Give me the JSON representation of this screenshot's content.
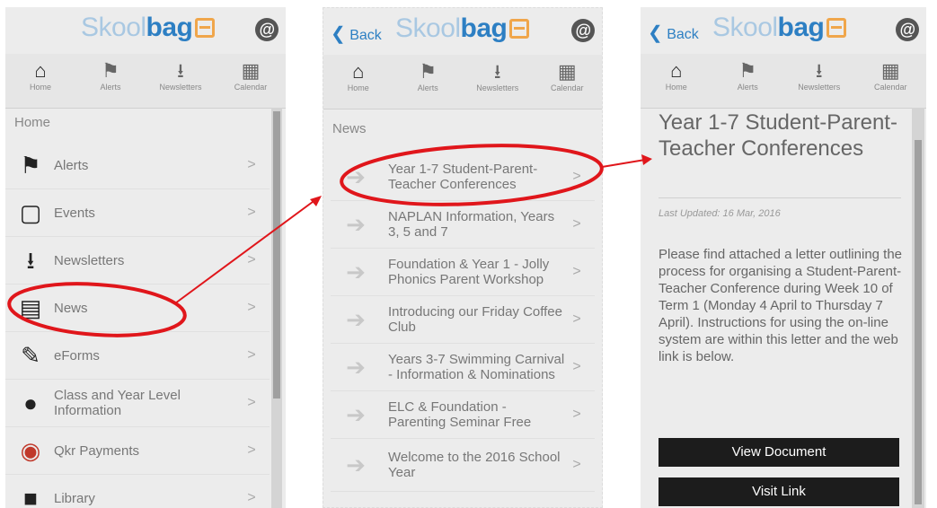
{
  "app": {
    "logo_part1": "Skool",
    "logo_part2": "bag",
    "back_label": "Back",
    "sync_glyph": "@"
  },
  "toolbar": [
    {
      "label": "Home",
      "icon": "home-icon",
      "glyph": "⌂"
    },
    {
      "label": "Alerts",
      "icon": "flag-icon",
      "glyph": "⚑"
    },
    {
      "label": "Newsletters",
      "icon": "inbox-icon",
      "glyph": "⭳"
    },
    {
      "label": "Calendar",
      "icon": "calendar-icon",
      "glyph": "▦"
    }
  ],
  "menu": {
    "section": "Home",
    "items": [
      {
        "label": "Alerts",
        "icon": "flag-icon",
        "glyph": "⚑"
      },
      {
        "label": "Events",
        "icon": "calendar-icon",
        "glyph": "▢"
      },
      {
        "label": "Newsletters",
        "icon": "inbox-icon",
        "glyph": "⭳"
      },
      {
        "label": "News",
        "icon": "newspaper-icon",
        "glyph": "▤"
      },
      {
        "label": "eForms",
        "icon": "form-icon",
        "glyph": "✎"
      },
      {
        "label": "Class and Year Level Information",
        "icon": "apple-icon",
        "glyph": "●"
      },
      {
        "label": "Qkr Payments",
        "icon": "qkr-icon",
        "glyph": "◉"
      },
      {
        "label": "Library",
        "icon": "book-icon",
        "glyph": "■"
      }
    ]
  },
  "news": {
    "section": "News",
    "items": [
      {
        "label": "Year 1-7 Student-Parent-Teacher Conferences"
      },
      {
        "label": "NAPLAN Information, Years 3, 5 and 7"
      },
      {
        "label": "Foundation & Year 1 - Jolly Phonics Parent Workshop"
      },
      {
        "label": "Introducing our Friday Coffee Club"
      },
      {
        "label": "Years 3-7 Swimming Carnival - Information & Nominations"
      },
      {
        "label": "ELC & Foundation - Parenting Seminar Free"
      },
      {
        "label": "Welcome to the 2016 School Year"
      }
    ]
  },
  "article": {
    "title": "Year 1-7 Student-Parent-Teacher Conferences",
    "updated": "Last Updated: 16 Mar, 2016",
    "body": "Please find attached a letter outlining the process for organising a Student-Parent-Teacher Conference during Week 10 of Term 1 (Monday 4 April to Thursday 7 April). Instructions for using the on-line system are within this letter and the web link is below.",
    "view_button": "View Document",
    "link_button": "Visit Link"
  },
  "colors": {
    "brand_blue": "#2d7fc3",
    "brand_light": "#a9c8e2",
    "bag_orange": "#f0a64b",
    "annotation_red": "#e0161b"
  }
}
